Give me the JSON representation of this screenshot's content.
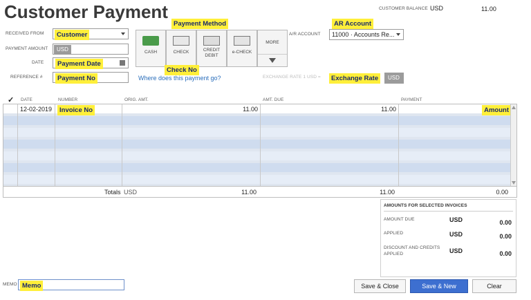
{
  "header": {
    "title": "Customer Payment",
    "balance_label": "CUSTOMER BALANCE",
    "balance_currency": "USD",
    "balance_value": "11.00"
  },
  "form": {
    "received_from_label": "RECEIVED FROM",
    "received_from_value": "Customer",
    "payment_amount_label": "PAYMENT AMOUNT",
    "payment_amount_currency": "USD",
    "date_label": "DATE",
    "date_value": "Payment Date",
    "reference_label": "REFERENCE #",
    "reference_value": "Payment No"
  },
  "payment_method": {
    "annotation": "Payment Method",
    "buttons": [
      {
        "label": "CASH"
      },
      {
        "label": "CHECK"
      },
      {
        "label": "CREDIT DEBIT"
      },
      {
        "label": "e-CHECK"
      },
      {
        "label": "MORE"
      }
    ],
    "check_no_annotation": "Check No",
    "where_link": "Where does this payment go?"
  },
  "ar": {
    "annotation": "AR Account",
    "label": "A/R ACCOUNT",
    "value": "11000 · Accounts Re..."
  },
  "exchange": {
    "label": "EXCHANGE RATE 1 USD =",
    "annotation": "Exchange Rate",
    "currency": "USD"
  },
  "table": {
    "check_mark": "✓",
    "headers": [
      "DATE",
      "NUMBER",
      "ORIG. AMT.",
      "AMT. DUE",
      "PAYMENT"
    ],
    "rows": [
      {
        "date": "12-02-2019",
        "number": "Invoice No",
        "orig_amt": "11.00",
        "amt_due": "11.00",
        "payment": "Amount"
      }
    ],
    "totals_label": "Totals",
    "totals_currency": "USD",
    "totals_orig": "11.00",
    "totals_due": "11.00",
    "totals_payment": "0.00"
  },
  "summary": {
    "title": "AMOUNTS FOR SELECTED INVOICES",
    "items": [
      {
        "label": "AMOUNT DUE",
        "currency": "USD",
        "value": "0.00"
      },
      {
        "label": "APPLIED",
        "currency": "USD",
        "value": "0.00"
      },
      {
        "label": "DISCOUNT AND CREDITS APPLIED",
        "currency": "USD",
        "value": "0.00"
      }
    ]
  },
  "memo": {
    "label": "MEMO",
    "value": "Memo"
  },
  "buttons": {
    "save_close": "Save & Close",
    "save_new": "Save & New",
    "clear": "Clear"
  }
}
